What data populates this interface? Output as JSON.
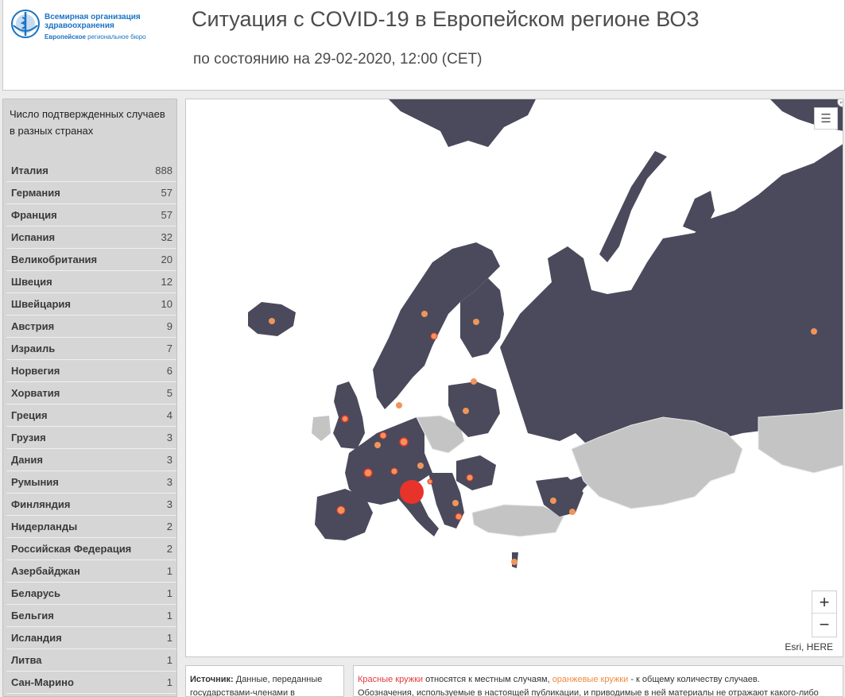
{
  "header": {
    "logo": {
      "line1": "Всемирная организация",
      "line2": "здравоохранения",
      "line3_bold": "Европейское",
      "line3_rest": " региональное бюро"
    },
    "title": "Ситуация с COVID-19 в Европейском регионе ВОЗ",
    "subtitle": "по состоянию на 29-02-2020, 12:00 (CET)"
  },
  "sidebar": {
    "title": "Число подтвержденных случаев в разных странах",
    "countries": [
      {
        "name": "Италия",
        "value": "888"
      },
      {
        "name": "Германия",
        "value": "57"
      },
      {
        "name": "Франция",
        "value": "57"
      },
      {
        "name": "Испания",
        "value": "32"
      },
      {
        "name": "Великобритания",
        "value": "20"
      },
      {
        "name": "Швеция",
        "value": "12"
      },
      {
        "name": "Швейцария",
        "value": "10"
      },
      {
        "name": "Австрия",
        "value": "9"
      },
      {
        "name": "Израиль",
        "value": "7"
      },
      {
        "name": "Норвегия",
        "value": "6"
      },
      {
        "name": "Хорватия",
        "value": "5"
      },
      {
        "name": "Греция",
        "value": "4"
      },
      {
        "name": "Грузия",
        "value": "3"
      },
      {
        "name": "Дания",
        "value": "3"
      },
      {
        "name": "Румыния",
        "value": "3"
      },
      {
        "name": "Финляндия",
        "value": "3"
      },
      {
        "name": "Нидерланды",
        "value": "2"
      },
      {
        "name": "Российская Федерация",
        "value": "2"
      },
      {
        "name": "Азербайджан",
        "value": "1"
      },
      {
        "name": "Беларусь",
        "value": "1"
      },
      {
        "name": "Бельгия",
        "value": "1"
      },
      {
        "name": "Исландия",
        "value": "1"
      },
      {
        "name": "Литва",
        "value": "1"
      },
      {
        "name": "Сан-Марино",
        "value": "1"
      }
    ]
  },
  "map": {
    "attribution": "Esri, HERE",
    "zoom_in": "+",
    "zoom_out": "−",
    "legend_icon": "legend-list-icon",
    "expand_icon": "expand-icon",
    "colors": {
      "affected": "#4a4a5c",
      "unaffected": "#c4c4c4",
      "local_case": "#e8332a",
      "total_case": "#f0955a"
    }
  },
  "footer": {
    "source_label": "Источник:",
    "source_text": " Данные, переданные государствами-членами в",
    "notes_red": "Красные кружки",
    "notes_mid": " относятся к местным случаям, ",
    "notes_orange": "оранжевые кружки",
    "notes_end": " - к общему количеству случаев.",
    "notes_line2": "Обозначения, используемые в настоящей публикации, и приводимые в ней материалы не отражают какого-либо"
  }
}
